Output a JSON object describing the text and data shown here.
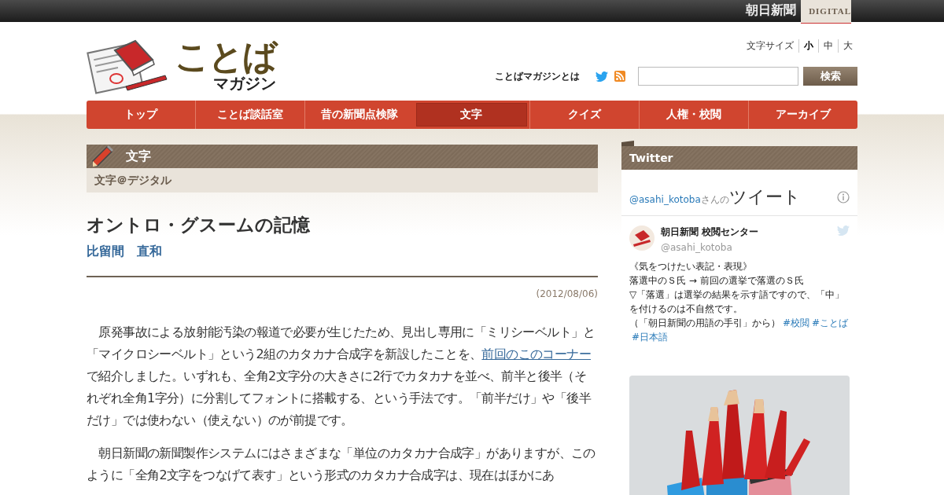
{
  "top_bar": {
    "brand": "朝日新聞",
    "brand_sub": "DIGITAL"
  },
  "logo": {
    "title": "ことば",
    "subtitle": "マガジン"
  },
  "font_size": {
    "label": "文字サイズ",
    "options": [
      {
        "label": "小",
        "selected": true
      },
      {
        "label": "中",
        "selected": false
      },
      {
        "label": "大",
        "selected": false
      }
    ]
  },
  "about_link": "ことばマガジンとは",
  "search": {
    "button": "検索"
  },
  "nav": [
    {
      "label": "トップ",
      "selected": false
    },
    {
      "label": "ことば談話室",
      "selected": false
    },
    {
      "label": "昔の新聞点検隊",
      "selected": false
    },
    {
      "label": "文字",
      "selected": true
    },
    {
      "label": "クイズ",
      "selected": false
    },
    {
      "label": "人権・校閲",
      "selected": false
    },
    {
      "label": "アーカイブ",
      "selected": false
    }
  ],
  "section": {
    "title": "文字",
    "subtitle": "文字＠デジタル"
  },
  "article": {
    "title": "オントロ・グスームの記憶",
    "author": "比留間　直和",
    "date": "(2012/08/06)",
    "paragraphs": [
      {
        "before": "　原発事故による放射能汚染の報道で必要が生じたため、見出し専用に「ミリシーベルト」と「マイクロシーベルト」という2組のカタカナ合成字を新設したことを、",
        "link": "前回のこのコーナー",
        "after": "で紹介しました。いずれも、全角2文字分の大きさに2行でカタカナを並べ、前半と後半（それぞれ全角1字分）に分割してフォントに搭載する、という手法です。「前半だけ」や「後半だけ」では使わない（使えない）のが前提です。"
      },
      {
        "before": "　朝日新聞の新聞製作システムにはさまざまな「単位のカタカナ合成字」がありますが、このように「全角2文字をつなげて表す」という形式のカタカナ合成字は、現在はほかにあ"
      }
    ]
  },
  "sidebar": {
    "title": "Twitter",
    "timeline": {
      "handle": "@asahi_kotoba",
      "suffix": "さんの",
      "heading": "ツイート"
    },
    "tweet": {
      "name": "朝日新聞 校閲センター",
      "handle": "@asahi_kotoba",
      "lines": [
        "《気をつけたい表記・表現》",
        "落選中のＳ氏 → 前回の選挙で落選のＳ氏",
        "▽「落選」は選挙の結果を示す語ですので、「中」を付けるのは不自然です。"
      ],
      "last_line": "（「朝日新聞の用語の手引」から）",
      "hashtags": [
        "#校閲",
        "#ことば",
        "#日本語"
      ]
    }
  }
}
